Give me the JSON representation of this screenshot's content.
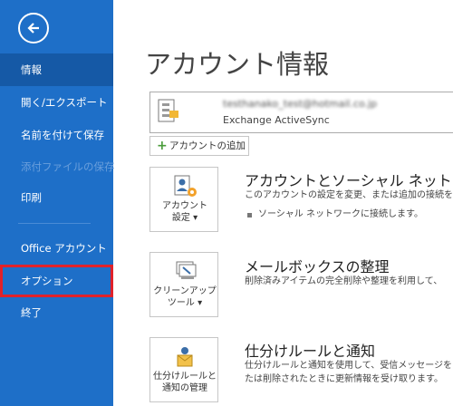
{
  "sidebar": {
    "items": [
      {
        "label": "情報"
      },
      {
        "label": "開く/エクスポート"
      },
      {
        "label": "名前を付けて保存"
      },
      {
        "label": "添付ファイルの保存"
      },
      {
        "label": "印刷"
      },
      {
        "label": "Office アカウント"
      },
      {
        "label": "オプション"
      },
      {
        "label": "終了"
      }
    ]
  },
  "page": {
    "title": "アカウント情報"
  },
  "account": {
    "email": "testhanako_test@hotmail.co.jp",
    "type": "Exchange ActiveSync"
  },
  "add_account_label": "アカウントの追加",
  "sections": [
    {
      "button_lines": [
        "アカウント",
        "設定 ▾"
      ],
      "title": "アカウントとソーシャル ネットワークの",
      "desc": "このアカウントの設定を変更、または追加の接続を設",
      "bullet": "ソーシャル ネットワークに接続します。"
    },
    {
      "button_lines": [
        "クリーンアップ",
        "ツール ▾"
      ],
      "title": "メールボックスの整理",
      "desc": "削除済みアイテムの完全削除や整理を利用して、"
    },
    {
      "button_lines": [
        "仕分けルールと",
        "通知の管理"
      ],
      "title": "仕分けルールと通知",
      "desc": "仕分けルールと通知を使用して、受信メッセージを",
      "desc2": "たは削除されたときに更新情報を受け取ります。"
    }
  ],
  "colors": {
    "sidebar": "#1e6fc8",
    "sidebar_active": "#1559a6",
    "highlight_box": "#e0222a"
  }
}
